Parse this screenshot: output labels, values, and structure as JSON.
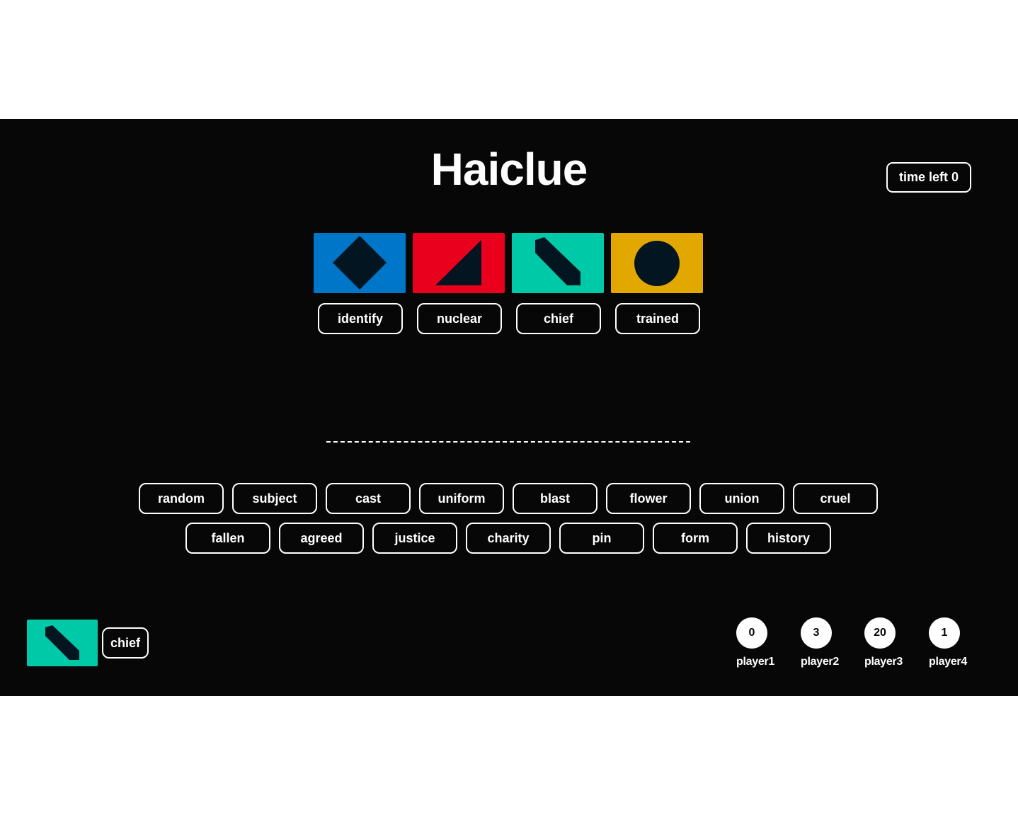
{
  "title": "Haiclue",
  "timer": {
    "label": "time left",
    "value": "0"
  },
  "colors": {
    "background": "#070707",
    "blue": "#0076c9",
    "red": "#e8001c",
    "teal": "#00c9a7",
    "gold": "#e2a800",
    "shape": "#021521"
  },
  "clue_cards": [
    {
      "shape": "diamond-icon",
      "color": "blue",
      "word": "identify"
    },
    {
      "shape": "triangle-icon",
      "color": "red",
      "word": "nuclear"
    },
    {
      "shape": "slash-icon",
      "color": "teal",
      "word": "chief"
    },
    {
      "shape": "circle-icon",
      "color": "gold",
      "word": "trained"
    }
  ],
  "divider": "---------------------------------------------------------",
  "word_pool": [
    [
      "random",
      "subject",
      "cast",
      "uniform",
      "blast",
      "flower",
      "union",
      "cruel"
    ],
    [
      "fallen",
      "agreed",
      "justice",
      "charity",
      "pin",
      "form",
      "history"
    ]
  ],
  "my_card": {
    "shape": "slash-icon",
    "color": "teal",
    "word": "chief"
  },
  "players": [
    {
      "name": "player1",
      "score": "0"
    },
    {
      "name": "player2",
      "score": "3"
    },
    {
      "name": "player3",
      "score": "20"
    },
    {
      "name": "player4",
      "score": "1"
    }
  ]
}
